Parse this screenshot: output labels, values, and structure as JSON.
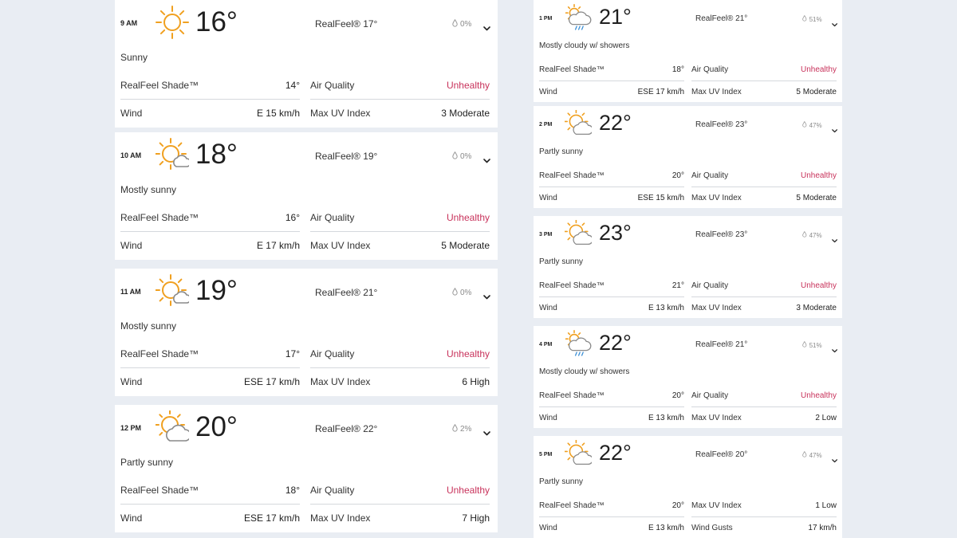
{
  "colors": {
    "background": "#e9edf3",
    "card": "#ffffff",
    "unhealthy": "#c8325b",
    "sun": "#f0a020",
    "cloud": "#8a8a8a",
    "rain": "#3a8fd6"
  },
  "left_hours": [
    {
      "time": "9 AM",
      "icon": "sunny-icon",
      "temp": "16°",
      "realfeel": "RealFeel® 17°",
      "precip": "0%",
      "phrase": "Sunny",
      "realfeel_shade_label": "RealFeel Shade™",
      "realfeel_shade": "14°",
      "air_quality_label": "Air Quality",
      "air_quality": "Unhealthy",
      "wind_label": "Wind",
      "wind": "E 15 km/h",
      "uv_label": "Max UV Index",
      "uv": "3 Moderate"
    },
    {
      "time": "10 AM",
      "icon": "mostly-sunny-icon",
      "temp": "18°",
      "realfeel": "RealFeel® 19°",
      "precip": "0%",
      "phrase": "Mostly sunny",
      "realfeel_shade_label": "RealFeel Shade™",
      "realfeel_shade": "16°",
      "air_quality_label": "Air Quality",
      "air_quality": "Unhealthy",
      "wind_label": "Wind",
      "wind": "E 17 km/h",
      "uv_label": "Max UV Index",
      "uv": "5 Moderate"
    },
    {
      "time": "11 AM",
      "icon": "mostly-sunny-icon",
      "temp": "19°",
      "realfeel": "RealFeel® 21°",
      "precip": "0%",
      "phrase": "Mostly sunny",
      "realfeel_shade_label": "RealFeel Shade™",
      "realfeel_shade": "17°",
      "air_quality_label": "Air Quality",
      "air_quality": "Unhealthy",
      "wind_label": "Wind",
      "wind": "ESE 17 km/h",
      "uv_label": "Max UV Index",
      "uv": "6 High"
    },
    {
      "time": "12 PM",
      "icon": "partly-sunny-icon",
      "temp": "20°",
      "realfeel": "RealFeel® 22°",
      "precip": "2%",
      "phrase": "Partly sunny",
      "realfeel_shade_label": "RealFeel Shade™",
      "realfeel_shade": "18°",
      "air_quality_label": "Air Quality",
      "air_quality": "Unhealthy",
      "wind_label": "Wind",
      "wind": "ESE 17 km/h",
      "uv_label": "Max UV Index",
      "uv": "7 High"
    }
  ],
  "right_hours": [
    {
      "time": "1 PM",
      "icon": "cloudy-showers-icon",
      "temp": "21°",
      "realfeel": "RealFeel® 21°",
      "precip": "51%",
      "phrase": "Mostly cloudy w/ showers",
      "realfeel_shade_label": "RealFeel Shade™",
      "realfeel_shade": "18°",
      "air_quality_label": "Air Quality",
      "air_quality": "Unhealthy",
      "wind_label": "Wind",
      "wind": "ESE 17 km/h",
      "uv_label": "Max UV Index",
      "uv": "5 Moderate"
    },
    {
      "time": "2 PM",
      "icon": "partly-sunny-icon",
      "temp": "22°",
      "realfeel": "RealFeel® 23°",
      "precip": "47%",
      "phrase": "Partly sunny",
      "realfeel_shade_label": "RealFeel Shade™",
      "realfeel_shade": "20°",
      "air_quality_label": "Air Quality",
      "air_quality": "Unhealthy",
      "wind_label": "Wind",
      "wind": "ESE 15 km/h",
      "uv_label": "Max UV Index",
      "uv": "5 Moderate"
    },
    {
      "time": "3 PM",
      "icon": "partly-sunny-icon",
      "temp": "23°",
      "realfeel": "RealFeel® 23°",
      "precip": "47%",
      "phrase": "Partly sunny",
      "realfeel_shade_label": "RealFeel Shade™",
      "realfeel_shade": "21°",
      "air_quality_label": "Air Quality",
      "air_quality": "Unhealthy",
      "wind_label": "Wind",
      "wind": "E 13 km/h",
      "uv_label": "Max UV Index",
      "uv": "3 Moderate"
    },
    {
      "time": "4 PM",
      "icon": "cloudy-showers-icon",
      "temp": "22°",
      "realfeel": "RealFeel® 21°",
      "precip": "51%",
      "phrase": "Mostly cloudy w/ showers",
      "realfeel_shade_label": "RealFeel Shade™",
      "realfeel_shade": "20°",
      "air_quality_label": "Air Quality",
      "air_quality": "Unhealthy",
      "wind_label": "Wind",
      "wind": "E 13 km/h",
      "uv_label": "Max UV Index",
      "uv": "2 Low"
    },
    {
      "time": "5 PM",
      "icon": "partly-sunny-icon",
      "temp": "22°",
      "realfeel": "RealFeel® 20°",
      "precip": "47%",
      "phrase": "Partly sunny",
      "realfeel_shade_label": "RealFeel Shade™",
      "realfeel_shade": "20°",
      "air_quality_label": "Max UV Index",
      "air_quality": "1 Low",
      "wind_label": "Wind",
      "wind": "E 13 km/h",
      "uv_label": "Wind Gusts",
      "uv": "17 km/h"
    }
  ]
}
